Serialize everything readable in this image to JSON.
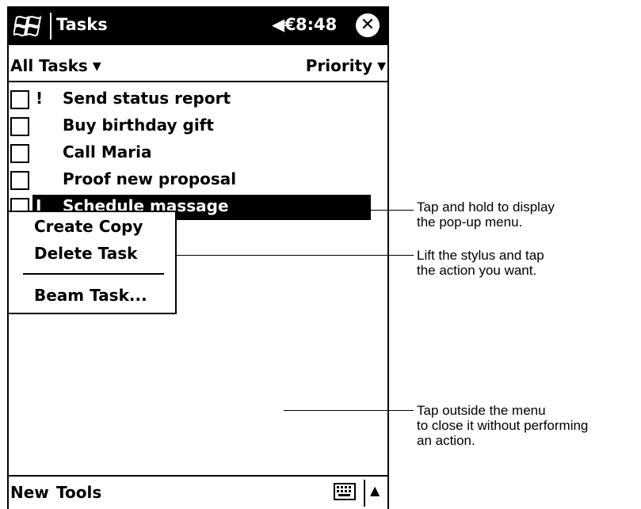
{
  "titlebar": {
    "title": "Tasks",
    "speaker": "◀€",
    "time": "8:48",
    "close": "✕"
  },
  "filter": {
    "category": "All Tasks",
    "sort": "Priority",
    "caret": "▼"
  },
  "tasks": [
    {
      "priority": "!",
      "name": "Send status report"
    },
    {
      "priority": "",
      "name": "Buy birthday gift"
    },
    {
      "priority": "",
      "name": "Call Maria"
    },
    {
      "priority": "",
      "name": "Proof new proposal"
    },
    {
      "priority": "I",
      "name": "Schedule massage"
    }
  ],
  "popup_menu": {
    "create_copy": "Create Copy",
    "delete_task": "Delete Task",
    "beam_task": "Beam Task..."
  },
  "menubar": {
    "new": "New",
    "tools": "Tools",
    "sip_arrow": "▲"
  },
  "callouts": [
    "Tap and hold to display\nthe pop-up menu.",
    "Lift the stylus and tap\nthe action you want.",
    "Tap outside the menu\nto close it without performing\nan action."
  ]
}
